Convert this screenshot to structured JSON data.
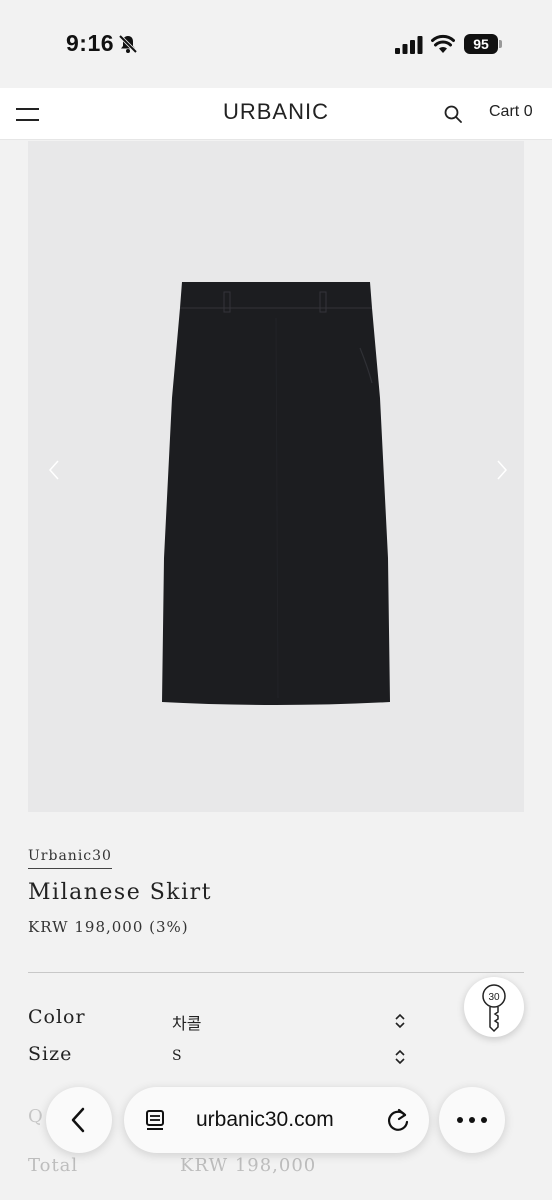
{
  "status_bar": {
    "time": "9:16",
    "battery": "95"
  },
  "header": {
    "logo": "URBANIC",
    "cart_label": "Cart",
    "cart_count": "0"
  },
  "product": {
    "brand": "Urbanic30",
    "name": "Milanese Skirt",
    "price": "KRW 198,000 (3%)"
  },
  "options": {
    "color": {
      "label": "Color",
      "value": "차콜"
    },
    "size": {
      "label": "Size",
      "value": "S"
    },
    "quantity_label": "Q",
    "total_label": "Total",
    "total_value": "KRW 198,000"
  },
  "browser": {
    "url": "urbanic30.com"
  },
  "fab": {
    "badge": "30"
  },
  "colors": {
    "skirt": "#1c1d20",
    "image_bg": "#e8e8e9",
    "page_bg": "#f2f2f2"
  }
}
